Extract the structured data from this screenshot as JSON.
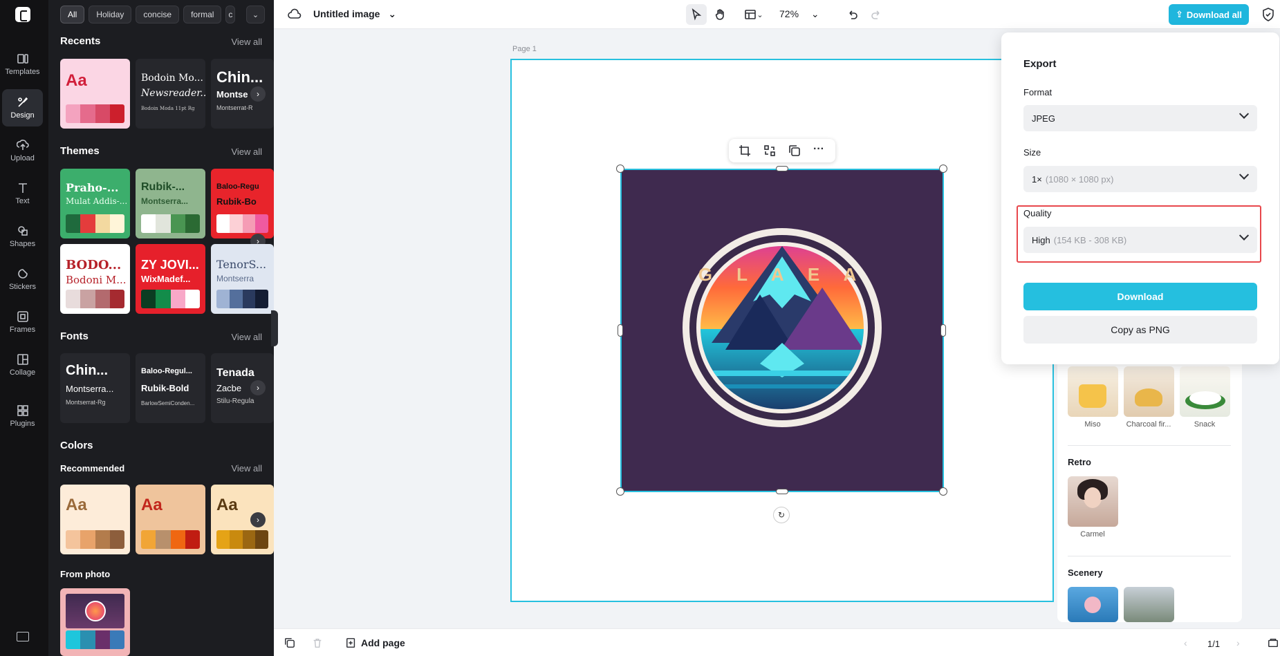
{
  "rail": {
    "items": [
      {
        "label": "Templates",
        "icon": "templates-icon"
      },
      {
        "label": "Design",
        "icon": "design-icon"
      },
      {
        "label": "Upload",
        "icon": "upload-icon"
      },
      {
        "label": "Text",
        "icon": "text-icon"
      },
      {
        "label": "Shapes",
        "icon": "shapes-icon"
      },
      {
        "label": "Stickers",
        "icon": "stickers-icon"
      },
      {
        "label": "Frames",
        "icon": "frames-icon"
      },
      {
        "label": "Collage",
        "icon": "collage-icon"
      },
      {
        "label": "Plugins",
        "icon": "plugins-icon"
      }
    ]
  },
  "panel": {
    "chips": [
      "All",
      "Holiday",
      "concise",
      "formal",
      "c"
    ],
    "recents": {
      "title": "Recents",
      "view_all": "View all",
      "cards": [
        {
          "big": "Aa"
        },
        {
          "l1": "Bodoin Mo...",
          "l2": "Newsreader...",
          "l3": "Bodoin Moda 11pt Rg"
        },
        {
          "l1": "Chin...",
          "l2": "Montse",
          "l3": "Montserrat-R"
        }
      ]
    },
    "themes": {
      "title": "Themes",
      "view_all": "View all",
      "cards": [
        {
          "l1": "Praho-...",
          "l2": "Mulat Addis-..."
        },
        {
          "l1": "Rubik-...",
          "l2": "Montserra..."
        },
        {
          "l1": "Baloo-Regu",
          "l2": "Rubik-Bo"
        },
        {
          "l1": "BODO...",
          "l2": "Bodoni M..."
        },
        {
          "l1": "ZY JOVI...",
          "l2": "WixMadef..."
        },
        {
          "l1": "TenorS...",
          "l2": "Montserra"
        }
      ]
    },
    "fonts": {
      "title": "Fonts",
      "view_all": "View all",
      "cards": [
        {
          "l1": "Chin...",
          "l2": "Montserra...",
          "l3": "Montserrat-Rg"
        },
        {
          "l1": "Baloo-Regul...",
          "l2": "Rubik-Bold",
          "l3": "BarlowSemiConden..."
        },
        {
          "l1": "Tenada",
          "l2": "Zacbe",
          "l3": "Stilu-Regula"
        }
      ]
    },
    "colors": {
      "title": "Colors",
      "recommended": "Recommended",
      "view_all": "View all",
      "cards": [
        {
          "big": "Aa"
        },
        {
          "big": "Aa"
        },
        {
          "big": "Aa"
        }
      ],
      "from_photo": "From photo"
    }
  },
  "topbar": {
    "doc_title": "Untitled image",
    "zoom": "72%",
    "download_all": "Download all"
  },
  "canvas": {
    "page_label": "Page 1",
    "logo_text": "G L A E A"
  },
  "bottombar": {
    "add_page": "Add page",
    "page_count": "1/1"
  },
  "export": {
    "title": "Export",
    "format_label": "Format",
    "format_value": "JPEG",
    "size_label": "Size",
    "size_value": "1×",
    "size_detail": "(1080 × 1080 px)",
    "quality_label": "Quality",
    "quality_value": "High",
    "quality_detail": "(154 KB - 308 KB)",
    "download": "Download",
    "copy_png": "Copy as PNG"
  },
  "styles": {
    "items": [
      "Miso",
      "Charcoal fir...",
      "Snack"
    ],
    "retro": {
      "title": "Retro",
      "items": [
        "Carmel"
      ]
    },
    "scenery": {
      "title": "Scenery"
    }
  }
}
